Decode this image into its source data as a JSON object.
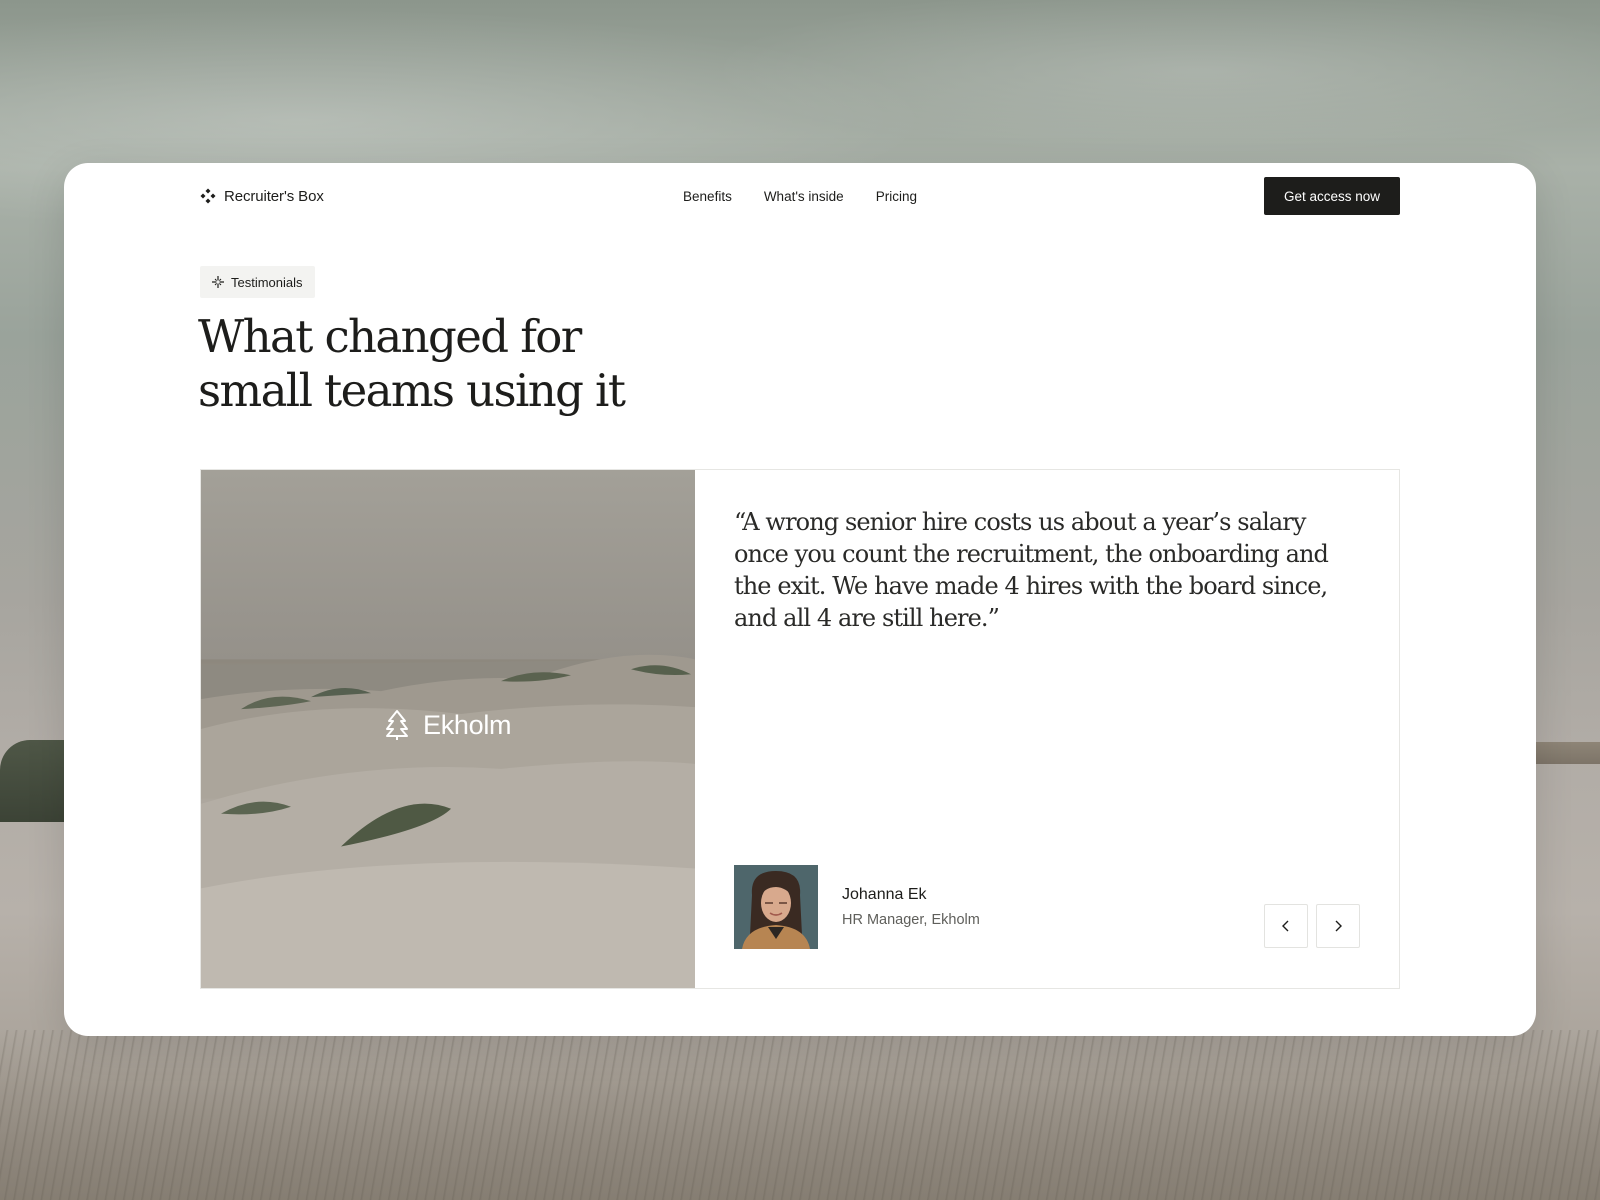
{
  "brand": {
    "name": "Recruiter's Box",
    "icon": "diamond-cluster-icon"
  },
  "nav": {
    "items": [
      {
        "label": "Benefits"
      },
      {
        "label": "What's inside"
      },
      {
        "label": "Pricing"
      }
    ],
    "cta_label": "Get access now"
  },
  "section": {
    "badge_label": "Testimonials",
    "badge_icon": "sparkle-icon",
    "title_line1": "What changed for",
    "title_line2": "small teams using it"
  },
  "testimonial": {
    "company": "Ekholm",
    "company_icon": "tree-icon",
    "quote": "“A wrong senior hire costs us about a year’s salary once you count the recruitment, the onboarding and the exit. We have made 4 hires with the board since, and all 4 are still here.”",
    "author_name": "Johanna Ek",
    "author_role": "HR Manager, Ekholm"
  },
  "controls": {
    "prev_icon": "chevron-left-icon",
    "next_icon": "chevron-right-icon"
  },
  "colors": {
    "text": "#1d1d1b",
    "cta_bg": "#1d1d1b",
    "badge_bg": "#f3f3f1",
    "card_bg": "#ffffff",
    "border": "#e6e6e3"
  }
}
